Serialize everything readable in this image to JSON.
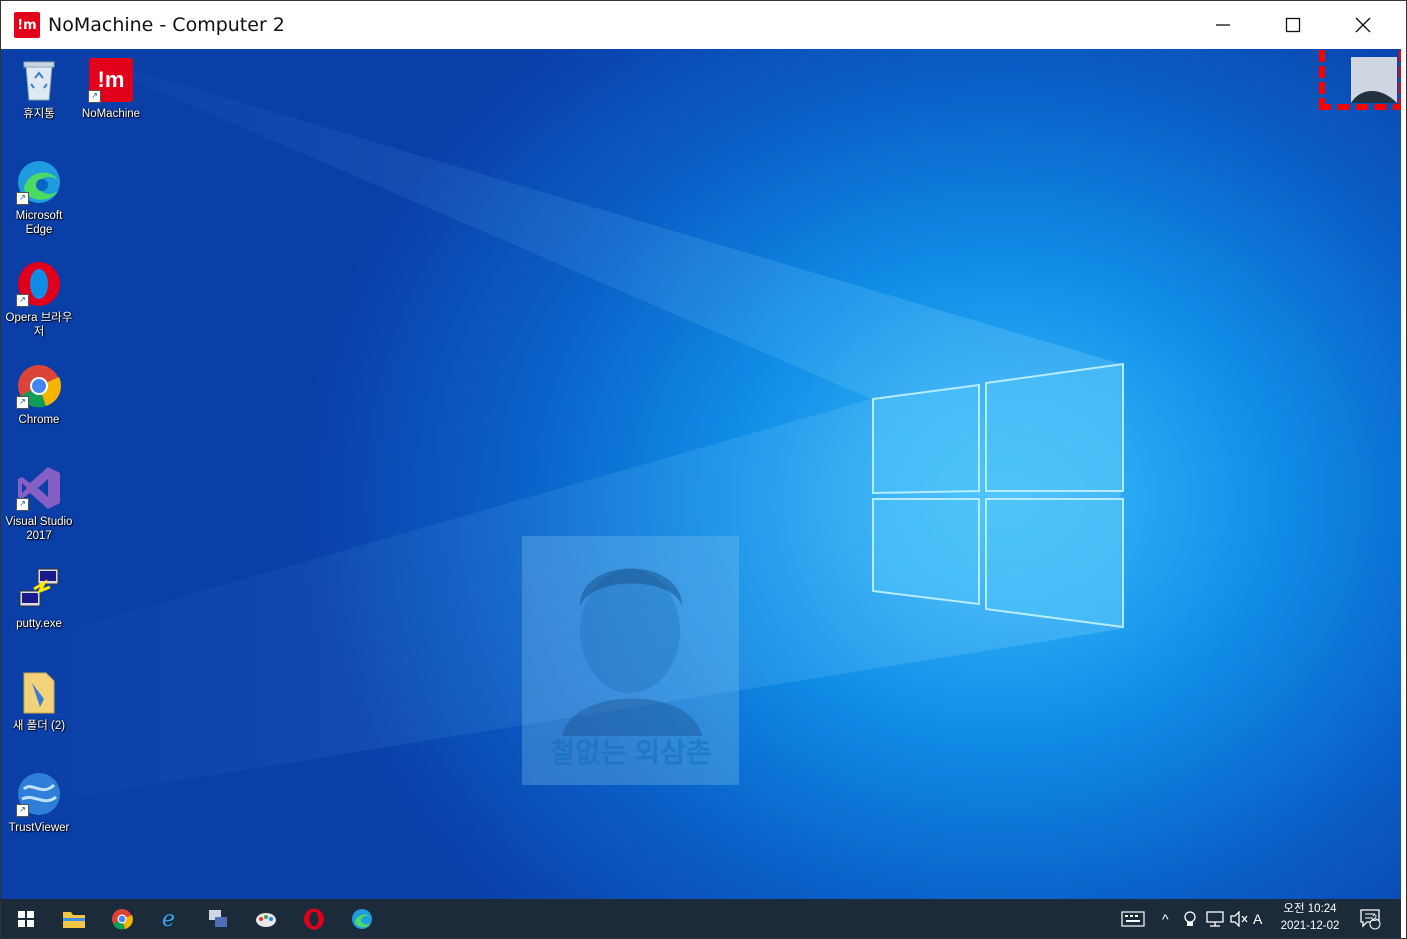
{
  "window": {
    "logo_text": "!m",
    "title": "NoMachine - Computer 2",
    "minimize_glyph": "—",
    "maximize_glyph": "☐",
    "close_glyph": "✕"
  },
  "desktop_icons": [
    {
      "label": "휴지통",
      "icon": "recycle-bin-icon"
    },
    {
      "label": "NoMachine",
      "icon": "nomachine-icon"
    },
    {
      "label": "Microsoft Edge",
      "icon": "edge-icon"
    },
    {
      "label": "Opera 브라우저",
      "icon": "opera-icon"
    },
    {
      "label": "Chrome",
      "icon": "chrome-icon"
    },
    {
      "label": "Visual Studio 2017",
      "icon": "visual-studio-icon"
    },
    {
      "label": "putty.exe",
      "icon": "putty-icon"
    },
    {
      "label": "새 폴더 (2)",
      "icon": "folder-icon"
    },
    {
      "label": "TrustViewer",
      "icon": "trustviewer-icon"
    }
  ],
  "watermark": {
    "text": "철없는 외삼촌"
  },
  "taskbar": {
    "apps": [
      "start-icon",
      "file-explorer-icon",
      "chrome-icon",
      "internet-explorer-icon",
      "network-app-icon",
      "paint-icon",
      "opera-icon",
      "edge-icon"
    ],
    "tray": {
      "chevron": "^",
      "ime": "A",
      "clock_time": "오전 10:24",
      "clock_date": "2021-12-02",
      "notification_count": "2"
    }
  },
  "colors": {
    "nomachine_red": "#e2001a",
    "highlight": "#ff0000",
    "taskbar": "#1c2b3a"
  }
}
